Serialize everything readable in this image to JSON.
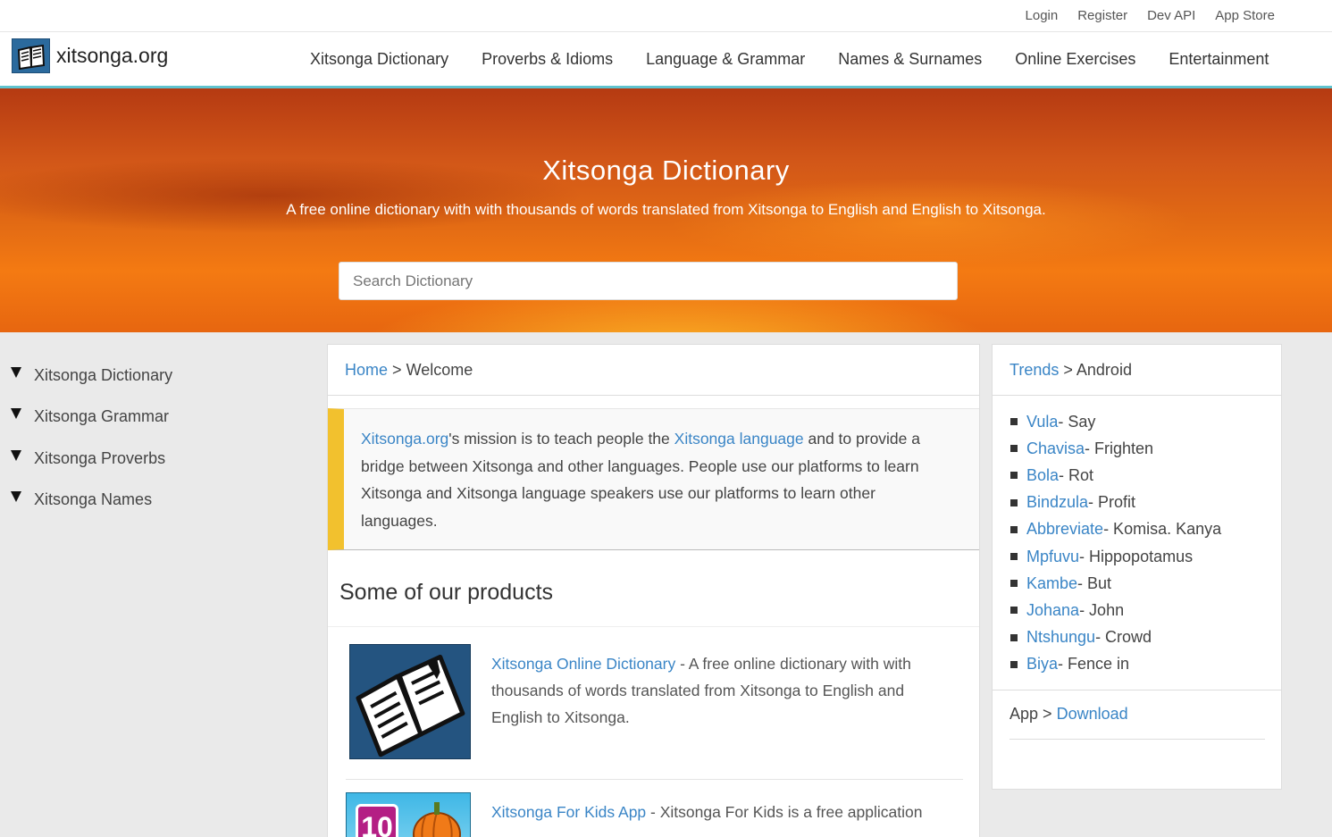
{
  "topbar": {
    "links": [
      "Login",
      "Register",
      "Dev API",
      "App Store"
    ]
  },
  "logo": {
    "text": "xitsonga.org",
    "icon": "book-icon"
  },
  "nav": [
    "Xitsonga Dictionary",
    "Proverbs & Idioms",
    "Language & Grammar",
    "Names & Surnames",
    "Online Exercises",
    "Entertainment"
  ],
  "hero": {
    "title": "Xitsonga Dictionary",
    "subtitle": "A free online dictionary with with thousands of words translated from Xitsonga to English and English to Xitsonga.",
    "search_placeholder": "Search Dictionary"
  },
  "sidebar": [
    "Xitsonga Dictionary",
    "Xitsonga Grammar",
    "Xitsonga Proverbs",
    "Xitsonga Names"
  ],
  "breadcrumb": {
    "home": "Home",
    "sep": ">",
    "current": "Welcome"
  },
  "mission": {
    "link1": "Xitsonga.org",
    "text1": "'s mission is to teach people the ",
    "link2": "Xitsonga language",
    "text2": " and to provide a bridge between Xitsonga and other languages. People use our platforms to learn Xitsonga and Xitsonga language speakers use our platforms to learn other languages."
  },
  "products": {
    "heading": "Some of our products",
    "items": [
      {
        "title": "Xitsonga Online Dictionary",
        "desc": " - A free online dictionary with with thousands of words translated from Xitsonga to English and English to Xitsonga."
      },
      {
        "title": "Xitsonga For Kids App",
        "desc": " - Xitsonga For Kids is a free application",
        "badge": "10"
      }
    ]
  },
  "trends": {
    "crumb_link": "Trends",
    "sep": ">",
    "crumb_current": "Android",
    "items": [
      {
        "word": "Vula",
        "meaning": " - Say"
      },
      {
        "word": "Chavisa",
        "meaning": " - Frighten"
      },
      {
        "word": "Bola",
        "meaning": " - Rot"
      },
      {
        "word": "Bindzula",
        "meaning": " - Profit"
      },
      {
        "word": "Abbreviate",
        "meaning": " - Komisa. Kanya"
      },
      {
        "word": "Mpfuvu",
        "meaning": " - Hippopotamus"
      },
      {
        "word": "Kambe",
        "meaning": " - But"
      },
      {
        "word": "Johana",
        "meaning": " - John"
      },
      {
        "word": "Ntshungu",
        "meaning": " - Crowd"
      },
      {
        "word": "Biya",
        "meaning": " - Fence in"
      }
    ],
    "app_label": "App",
    "app_link": "Download"
  }
}
